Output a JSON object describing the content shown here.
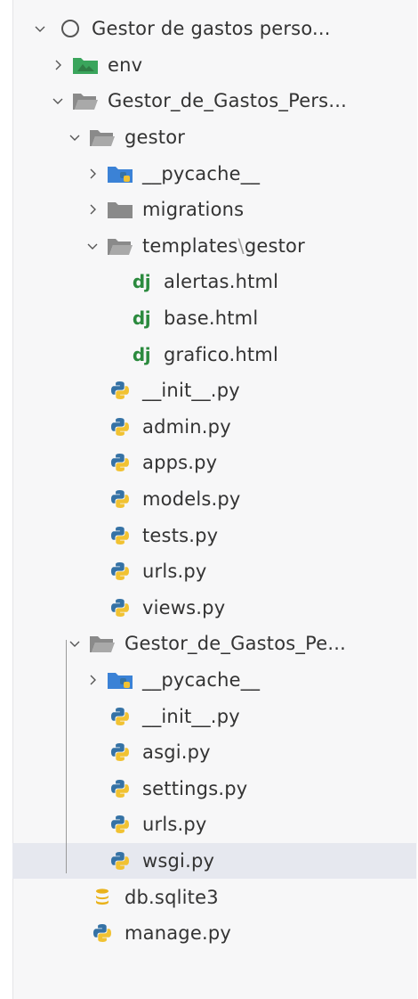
{
  "explorer": {
    "project": {
      "label": "Gestor de gastos perso...",
      "icon": "circle-icon"
    },
    "items": [
      {
        "label": "env",
        "type": "folder-env",
        "expanded": false
      },
      {
        "label": "Gestor_de_Gastos_Pers...",
        "type": "folder",
        "expanded": true
      },
      {
        "label": "gestor",
        "type": "folder",
        "expanded": true
      },
      {
        "label": "__pycache__",
        "type": "folder-pycache",
        "expanded": false
      },
      {
        "label": "migrations",
        "type": "folder-closed",
        "expanded": false
      },
      {
        "label_main": "templates",
        "label_sep": "\\",
        "label_sub": "gestor",
        "type": "folder",
        "expanded": true
      },
      {
        "label": "alertas.html",
        "type": "django"
      },
      {
        "label": "base.html",
        "type": "django"
      },
      {
        "label": "grafico.html",
        "type": "django"
      },
      {
        "label": "__init__.py",
        "type": "python"
      },
      {
        "label": "admin.py",
        "type": "python"
      },
      {
        "label": "apps.py",
        "type": "python"
      },
      {
        "label": "models.py",
        "type": "python"
      },
      {
        "label": "tests.py",
        "type": "python"
      },
      {
        "label": "urls.py",
        "type": "python"
      },
      {
        "label": "views.py",
        "type": "python"
      },
      {
        "label": "Gestor_de_Gastos_Pe...",
        "type": "folder",
        "expanded": true
      },
      {
        "label": "__pycache__",
        "type": "folder-pycache",
        "expanded": false
      },
      {
        "label": "__init__.py",
        "type": "python"
      },
      {
        "label": "asgi.py",
        "type": "python"
      },
      {
        "label": "settings.py",
        "type": "python"
      },
      {
        "label": "urls.py",
        "type": "python"
      },
      {
        "label": "wsgi.py",
        "type": "python",
        "selected": true
      },
      {
        "label": "db.sqlite3",
        "type": "database"
      },
      {
        "label": "manage.py",
        "type": "python"
      }
    ],
    "django_badge": "dj"
  },
  "colors": {
    "folder_gray": "#8a8a8a",
    "env_green": "#3aa55c",
    "pycache_blue": "#3b82d6",
    "python_blue": "#3572A5",
    "python_yellow": "#F1C232",
    "django_green": "#2b8a3e",
    "sqlite_yellow": "#E9B21B",
    "selection": "#e6e8ef"
  }
}
